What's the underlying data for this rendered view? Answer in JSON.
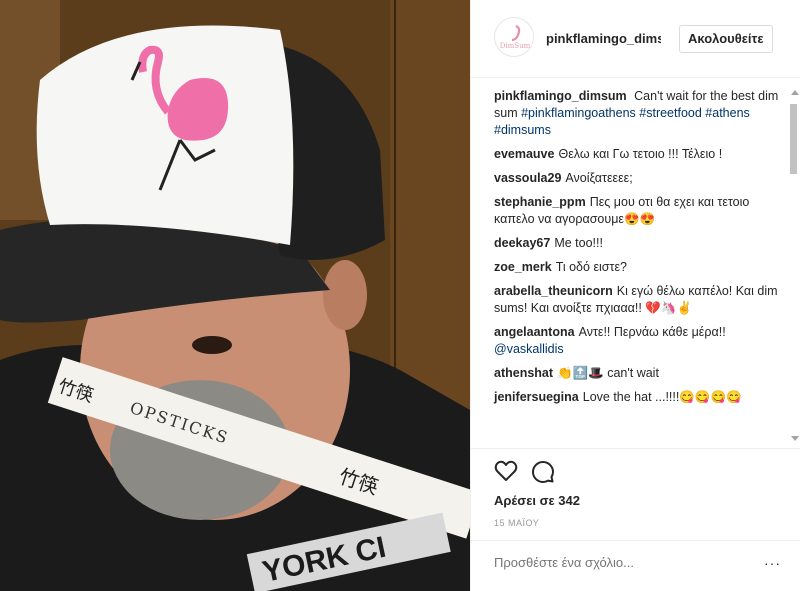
{
  "post": {
    "avatar_text": "DimSum",
    "username": "pinkflamingo_dimsum",
    "follow_label": "Ακολουθείτε",
    "caption": {
      "user": "pinkflamingo_dimsum",
      "text": "Can't wait for the best dim sum",
      "tags": [
        "#pinkflamingoathens",
        "#streetfood",
        "#athens",
        "#dimsums"
      ]
    },
    "likes": "Αρέσει σε 342",
    "date": "15 ΜΑΪΟΥ",
    "add_comment_placeholder": "Προσθέστε ένα σχόλιο...",
    "more_label": "···"
  },
  "photo": {
    "chopsticks_text": "OPSTICKS",
    "chopsticks_chars": "竹筷",
    "shirt_text": "YORK CI"
  },
  "comments": [
    {
      "user": "evemauve",
      "text": "Θελω και Γω τετοιο !!! Τέλειο !"
    },
    {
      "user": "vassoula29",
      "text": "Ανοίξατεεεε;"
    },
    {
      "user": "stephanie_ppm",
      "text": "Πες μου οτι θα εχει και τετοιο καπελο να αγορασουμε😍😍"
    },
    {
      "user": "deekay67",
      "text": "Me too!!!"
    },
    {
      "user": "zoe_merk",
      "text": "Τι οδό ειστε?"
    },
    {
      "user": "arabella_theunicorn",
      "text": "Κι εγώ θέλω καπέλο! Και dim sums! Και ανοίξτε πχιααα!! 💔🦄✌"
    },
    {
      "user": "angelaantona",
      "text": "Αντε!! Περνάω κάθε μέρα!!",
      "mention": "@vaskallidis"
    },
    {
      "user": "athenshat",
      "text": "👏🔝🎩 can't wait"
    },
    {
      "user": "jenifersuegina",
      "text": "Love the hat ...!!!!😋😋😋😋"
    }
  ]
}
